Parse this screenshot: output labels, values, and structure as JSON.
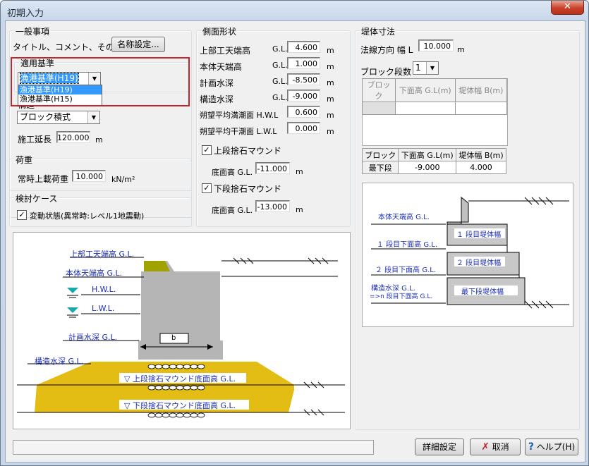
{
  "window": {
    "title": "初期入力",
    "close_glyph": "✕"
  },
  "general": {
    "title": "一般事項",
    "desc_label": "タイトル、コメント、その他:",
    "name_button": "名称設定..."
  },
  "standard": {
    "title": "適用基準",
    "selected": "漁港基準(H19)",
    "options": [
      "漁港基準(H19)",
      "漁港基準(H15)"
    ]
  },
  "structure": {
    "title": "構造",
    "selected": "ブロック積式"
  },
  "extension": {
    "label": "施工延長",
    "value": "120.000",
    "unit": "m"
  },
  "load": {
    "title": "荷重",
    "label": "常時上載荷重",
    "value": "10.000",
    "unit": "kN/m²"
  },
  "cases": {
    "title": "検討ケース",
    "check_label": "変動状態(異常時:レベル1地震動)",
    "checked": true
  },
  "cross": {
    "title": "側面形状",
    "rows": [
      {
        "label": "上部工天端高",
        "gl": "G.L.",
        "value": "4.600",
        "unit": "m"
      },
      {
        "label": "本体天端高",
        "gl": "G.L.",
        "value": "1.000",
        "unit": "m"
      },
      {
        "label": "計画水深",
        "gl": "G.L.",
        "value": "-8.500",
        "unit": "m"
      },
      {
        "label": "構造水深",
        "gl": "G.L.",
        "value": "-9.000",
        "unit": "m"
      },
      {
        "label": "朔望平均満潮面 H.W.L",
        "gl": "",
        "value": "0.600",
        "unit": "m"
      },
      {
        "label": "朔望平均干潮面 L.W.L",
        "gl": "",
        "value": "0.000",
        "unit": "m"
      }
    ],
    "upper_mound": {
      "label": "上段捨石マウンド",
      "checked": true,
      "bottom_label": "底面高 G.L.",
      "value": "-11.000",
      "unit": "m"
    },
    "lower_mound": {
      "label": "下段捨石マウンド",
      "checked": true,
      "bottom_label": "底面高 G.L.",
      "value": "-13.000",
      "unit": "m"
    }
  },
  "dike": {
    "title": "堤体寸法",
    "normal_label": "法線方向 幅 L",
    "normal_value": "10.000",
    "normal_unit": "m",
    "blocks_label": "ブロック段数",
    "blocks_value": "1",
    "table_headers": [
      "ブロック",
      "下面高 G.L(m)",
      "堤体幅 B(m)"
    ],
    "bottom_headers": [
      "ブロック",
      "下面高 G.L(m)",
      "堤体幅 B(m)"
    ],
    "bottom_row": [
      "最下段",
      "-9.000",
      "4.000"
    ]
  },
  "diagram": {
    "top_gl": "上部工天端高 G.L.",
    "body_gl": "本体天端高 G.L.",
    "hwl": "H.W.L.",
    "lwl": "L.W.L.",
    "plan_depth": "計画水深 G.L.",
    "struct_depth": "構造水深 G.L.",
    "b": "b",
    "upper_mound": "▽  上段捨石マウンド底面高  G.L.",
    "lower_mound": "▽  下段捨石マウンド底面高 G.L."
  },
  "block_diagram": {
    "body_top": "本体天端高 G.L.",
    "first_bottom": "１ 段目下面高 G.L.",
    "second_bottom": "２ 段目下面高 G.L.",
    "struct_depth": "構造水深 G.L.",
    "nth_bottom": "=>n 段目下面高 G.L.",
    "first_width": "１ 段目堤体幅",
    "second_width": "２ 段目堤体幅",
    "last_width": "最下段堤体幅"
  },
  "footer": {
    "detail_button": "詳細設定",
    "cancel_button": "取消",
    "help_button": "ヘルプ(H)",
    "status": ""
  },
  "colors": {
    "mound": "#e8c01a",
    "body": "#b5b5b5",
    "cap": "#a1a100",
    "water": "#1aa7b0",
    "label_blue": "#1b2fb5",
    "highlight_box": "#c0272d"
  }
}
